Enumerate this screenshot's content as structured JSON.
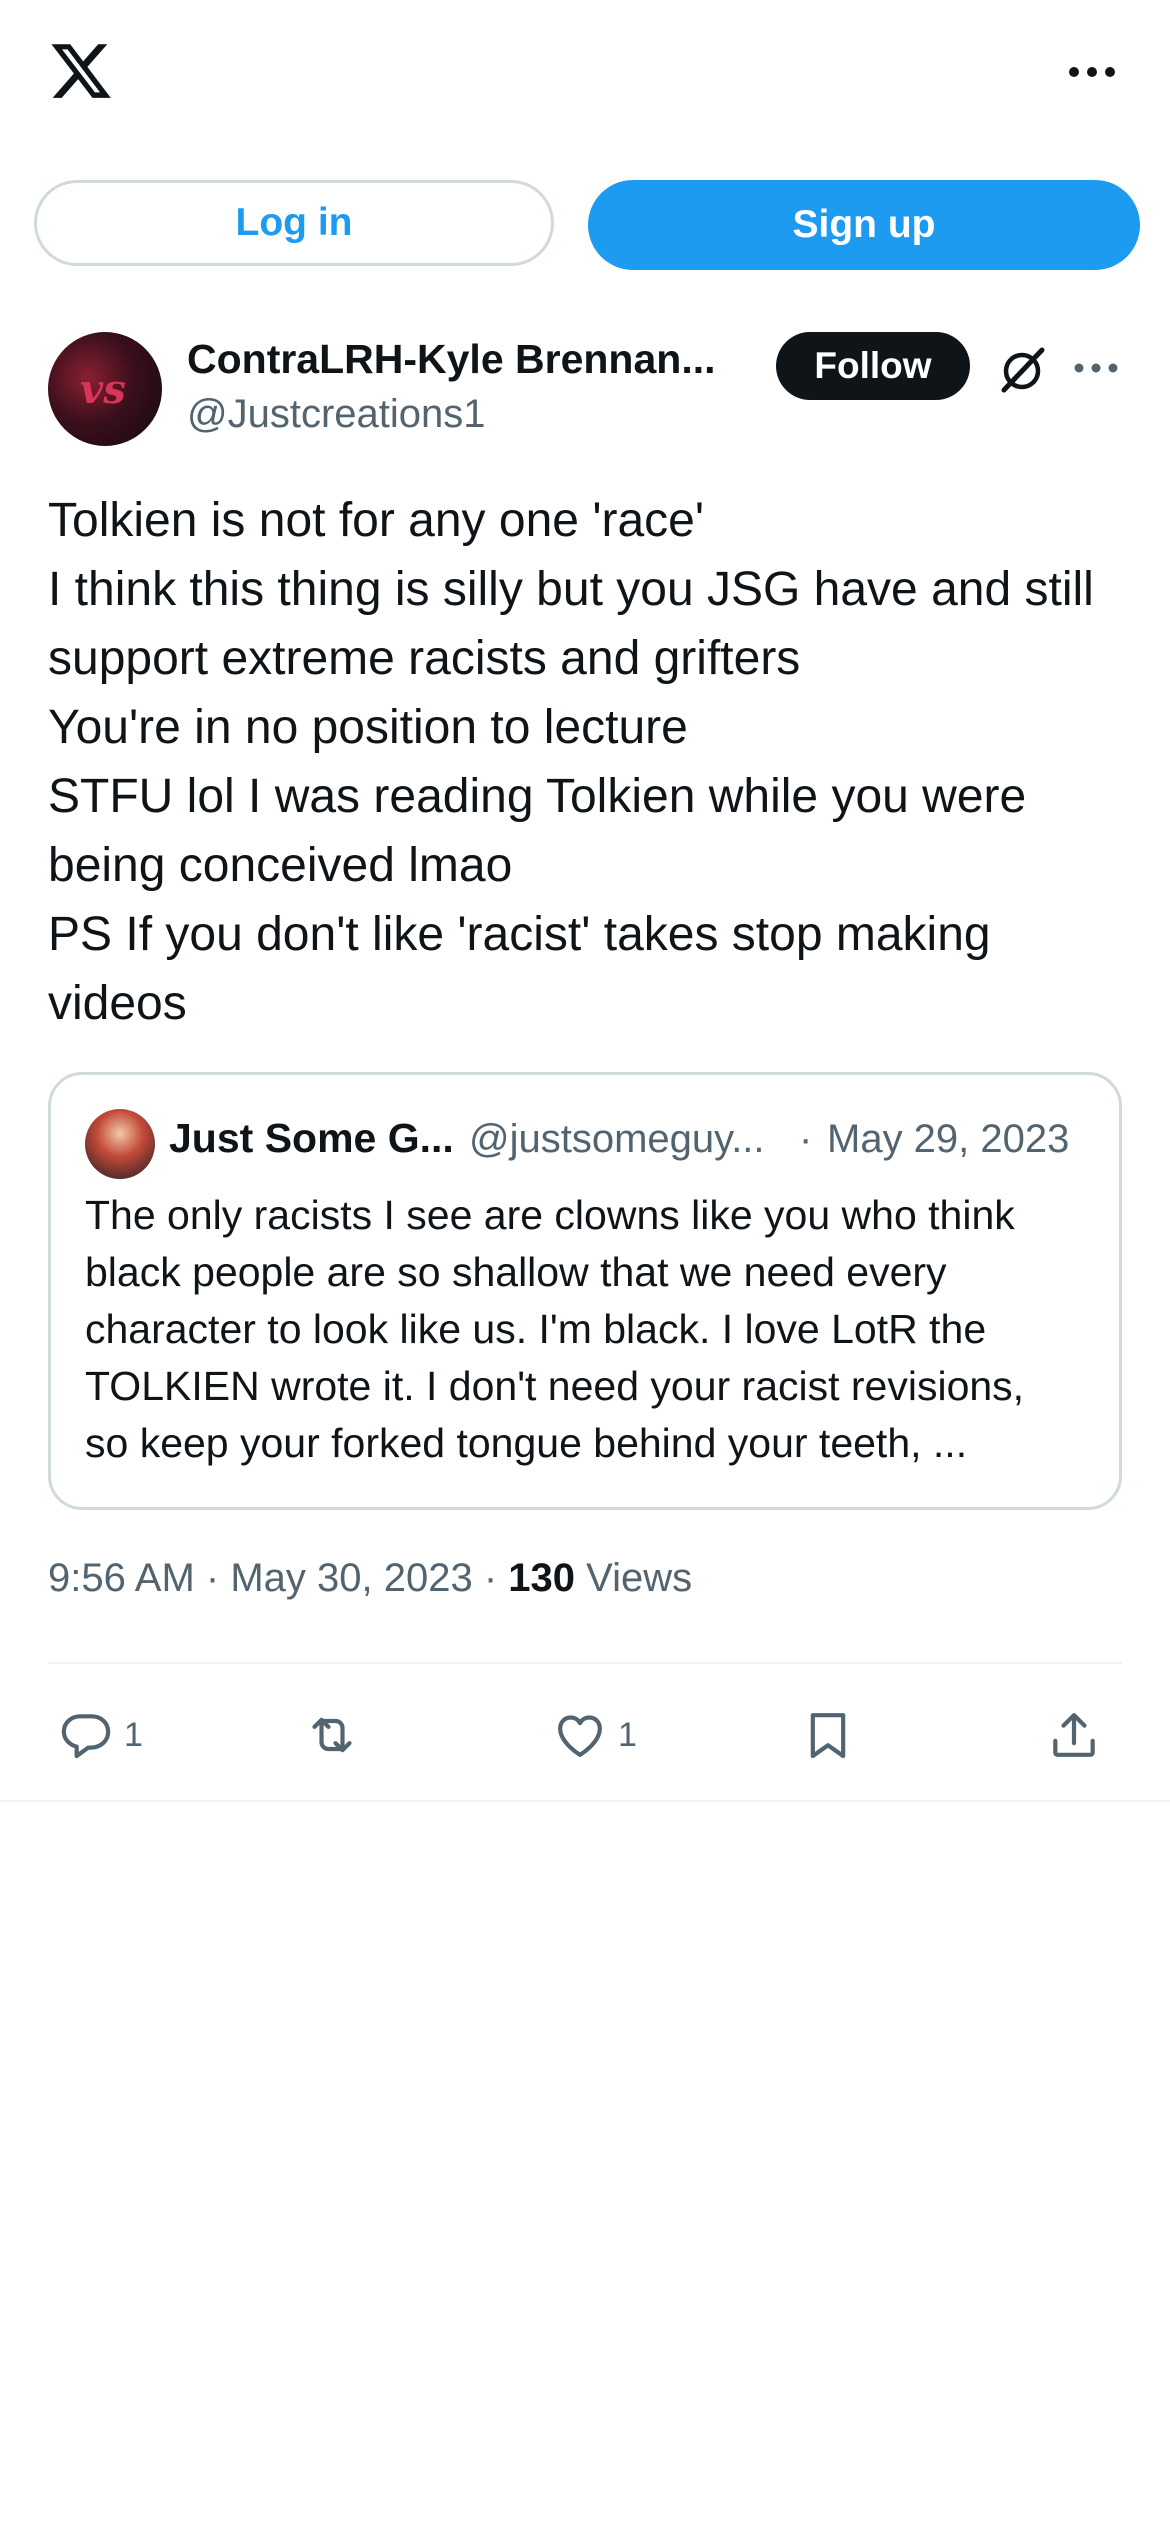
{
  "header": {
    "logo": "x-logo",
    "more": "more-options-icon"
  },
  "auth": {
    "login_label": "Log in",
    "signup_label": "Sign up"
  },
  "post": {
    "author_name": "ContraLRH-Kyle Brennan...",
    "author_handle": "@Justcreations1",
    "follow_label": "Follow",
    "body_lines": [
      "Tolkien is not for any one 'race'",
      "I think this thing is silly but you JSG have and still",
      "support extreme racists and grifters",
      "You're in no position to lecture",
      "STFU lol I was reading Tolkien while you were",
      "being conceived lmao",
      "PS If you don't like 'racist' takes stop making",
      "videos"
    ],
    "time": "9:56 AM",
    "date": "May 30, 2023",
    "views_count": "130",
    "views_label": "Views"
  },
  "quote": {
    "author_name": "Just Some G...",
    "author_handle": "@justsomeguy...",
    "separator": "·",
    "date": "May 29, 2023",
    "text_lines": [
      "The only racists I see are clowns like you who think",
      "black people are so shallow that we need every",
      "character to look like us. I'm black. I love LotR the",
      "TOLKIEN wrote it. I don't need your racist revisions,",
      "so keep your forked tongue behind your teeth, ..."
    ]
  },
  "actions": {
    "reply_count": "1",
    "like_count": "1"
  },
  "colors": {
    "accent": "#1d9bf0",
    "text": "#0f1419",
    "secondary": "#536471",
    "border": "#cfd9de"
  }
}
